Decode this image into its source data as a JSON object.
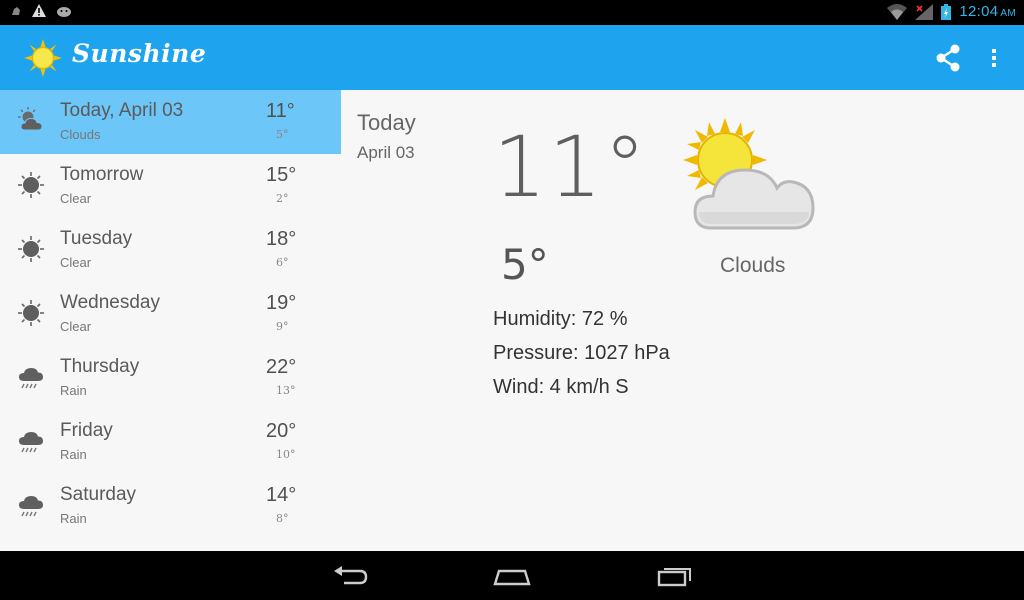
{
  "status_bar": {
    "time": "12:04",
    "ampm": "AM",
    "left_icons": [
      "notification-icon",
      "warning-icon",
      "android-icon"
    ],
    "right_icons": [
      "wifi-icon",
      "signal-icon",
      "battery-icon"
    ]
  },
  "action_bar": {
    "title": "Sunshine",
    "logo_icon": "sun-icon",
    "share_icon": "share-icon",
    "menu_icon": "overflow-menu-icon"
  },
  "forecast": [
    {
      "day": "Today, April 03",
      "desc": "Clouds",
      "high": "11°",
      "low": "5°",
      "icon": "clouds-icon",
      "selected": true
    },
    {
      "day": "Tomorrow",
      "desc": "Clear",
      "high": "15°",
      "low": "2°",
      "icon": "clear-icon"
    },
    {
      "day": "Tuesday",
      "desc": "Clear",
      "high": "18°",
      "low": "6°",
      "icon": "clear-icon"
    },
    {
      "day": "Wednesday",
      "desc": "Clear",
      "high": "19°",
      "low": "9°",
      "icon": "clear-icon"
    },
    {
      "day": "Thursday",
      "desc": "Rain",
      "high": "22°",
      "low": "13°",
      "icon": "rain-icon"
    },
    {
      "day": "Friday",
      "desc": "Rain",
      "high": "20°",
      "low": "10°",
      "icon": "rain-icon"
    },
    {
      "day": "Saturday",
      "desc": "Rain",
      "high": "14°",
      "low": "8°",
      "icon": "rain-icon"
    }
  ],
  "detail": {
    "day": "Today",
    "date": "April 03",
    "high": "11°",
    "low": "5°",
    "desc": "Clouds",
    "humidity": "Humidity: 72 %",
    "pressure": "Pressure: 1027 hPa",
    "wind": "Wind: 4 km/h S"
  },
  "colors": {
    "action_bar": "#1ea3ee",
    "selected_row": "#6cc6f7",
    "clock": "#33b5e5"
  }
}
